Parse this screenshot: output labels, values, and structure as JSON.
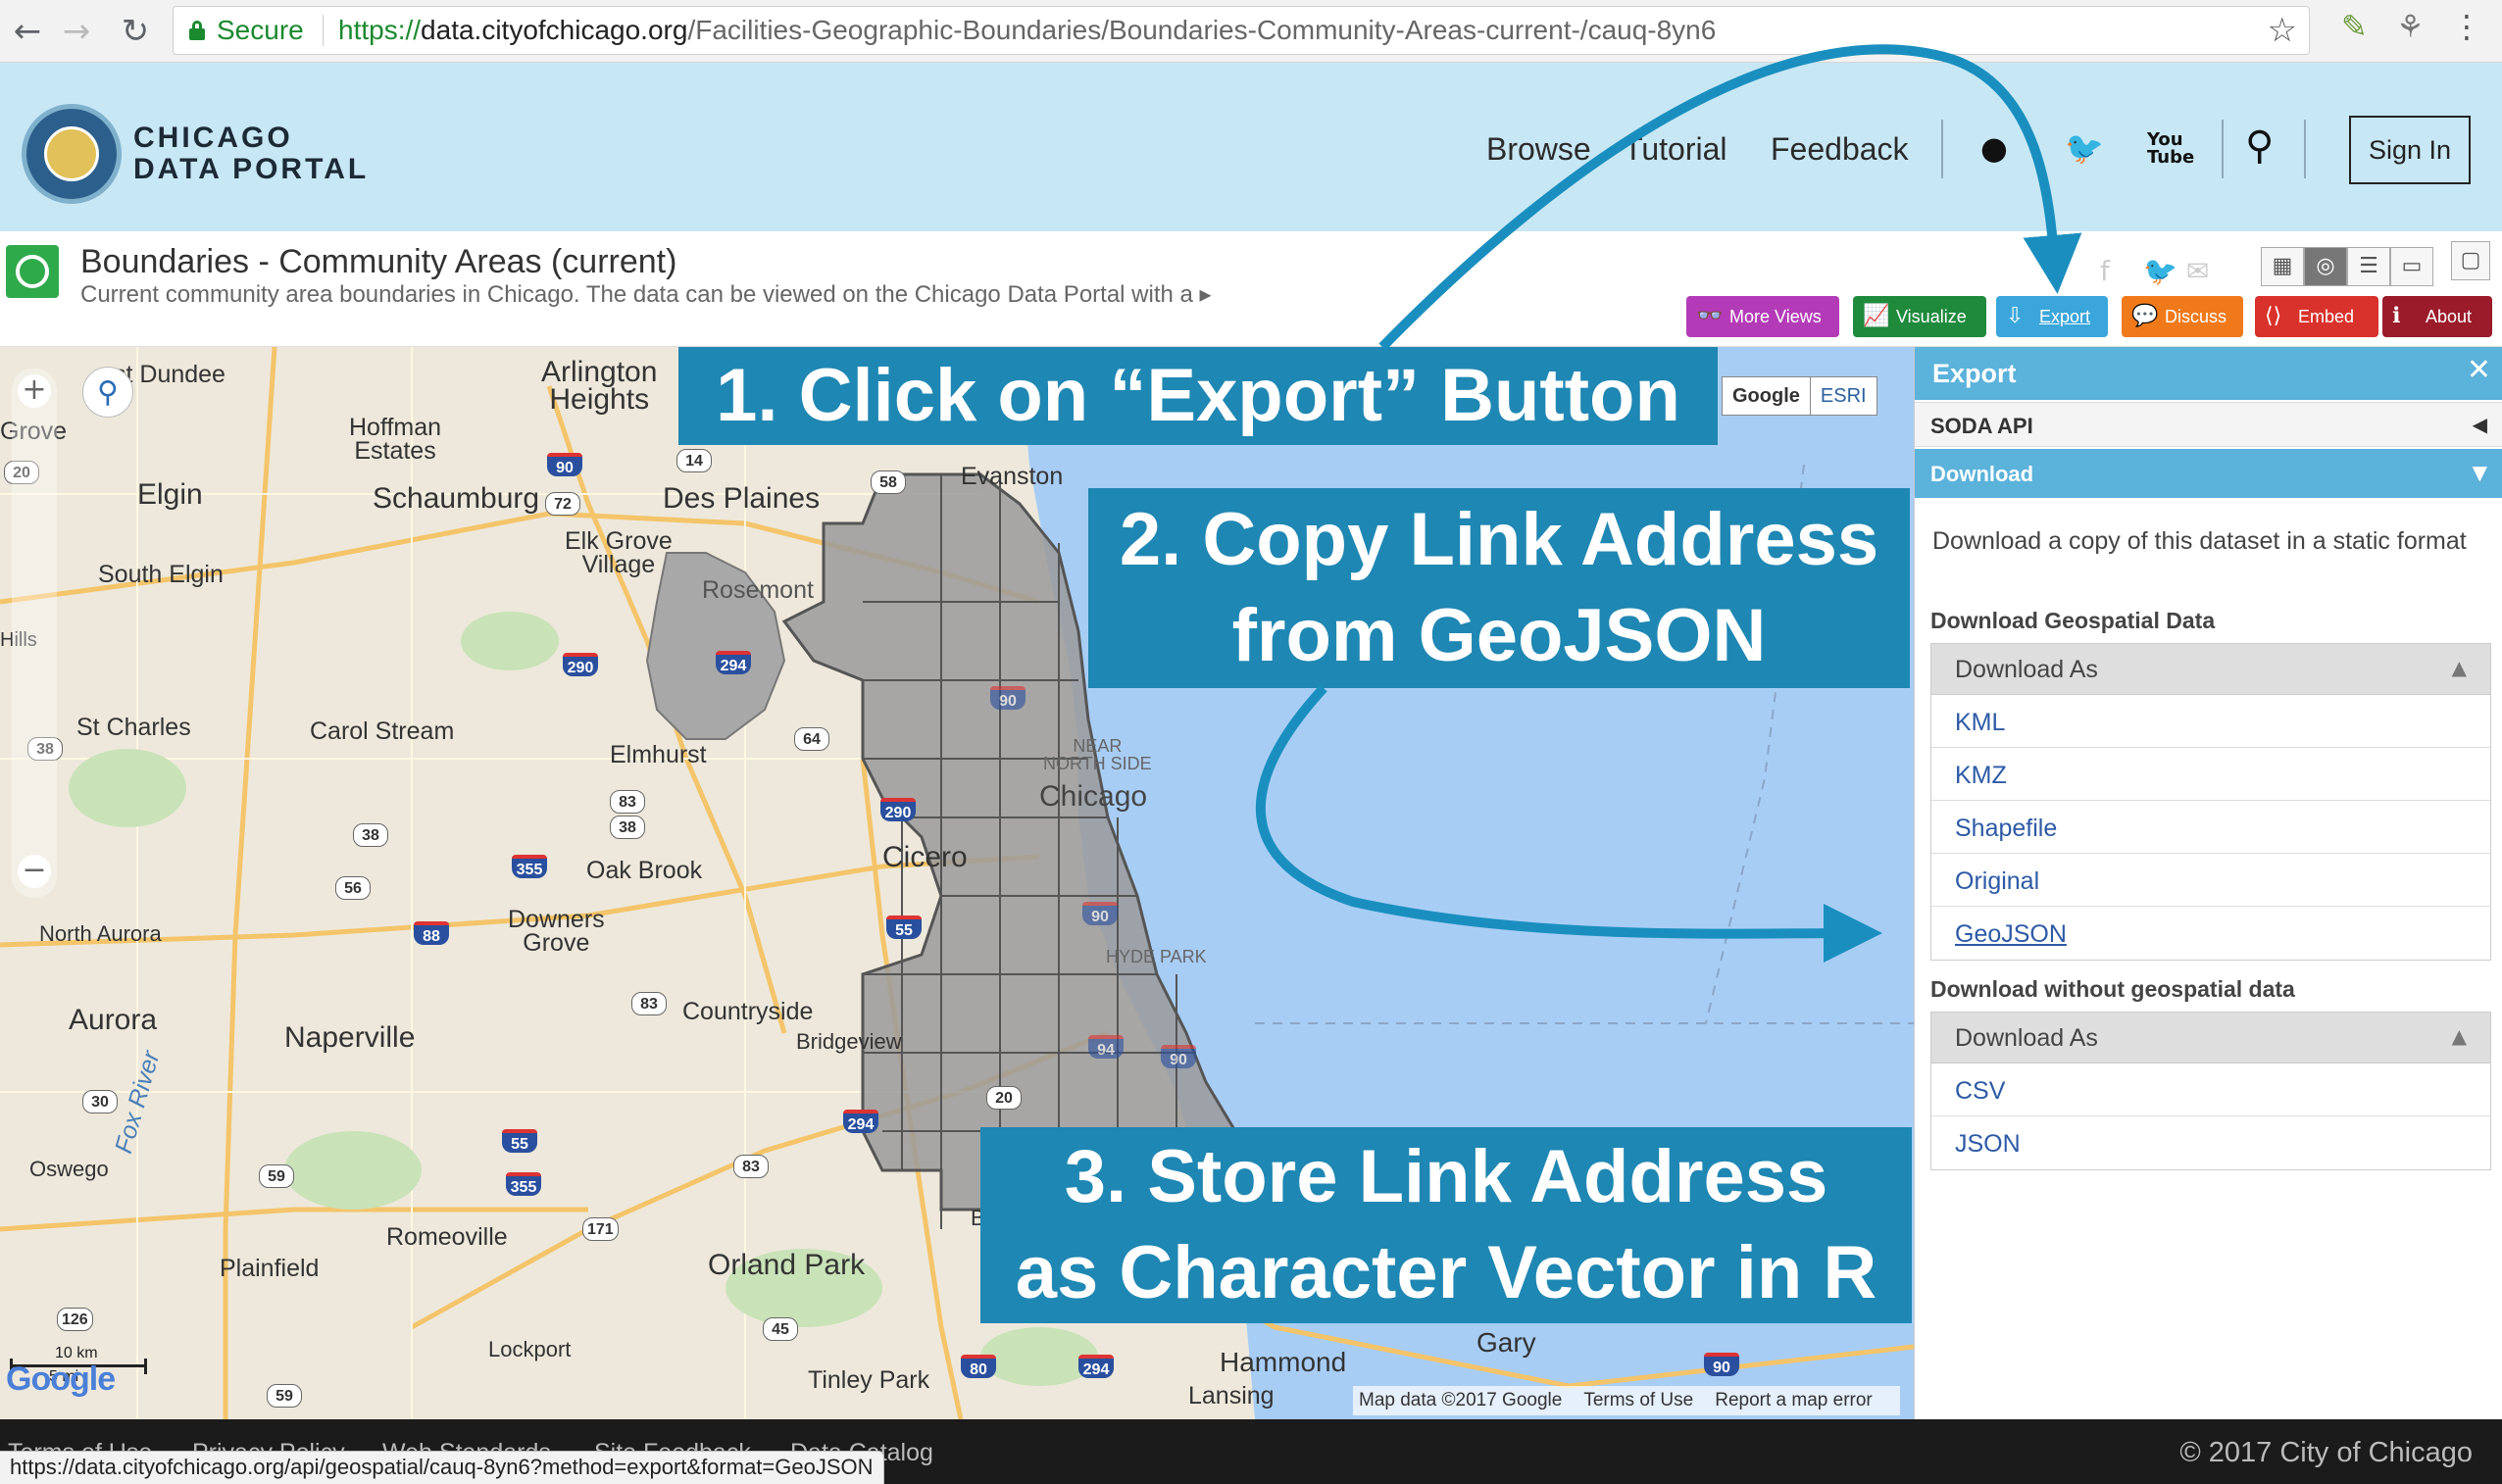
{
  "browser": {
    "secure_label": "Secure",
    "url_scheme": "https://",
    "url_host": "data.cityofchicago.org",
    "url_path": "/Facilities-Geographic-Boundaries/Boundaries-Community-Areas-current-/cauq-8yn6",
    "back_glyph": "←",
    "forward_glyph": "→",
    "reload_glyph": "↻",
    "star_glyph": "☆",
    "menu_glyph": "⋮"
  },
  "header": {
    "logo_line1": "CHICAGO",
    "logo_line2": "DATA PORTAL",
    "nav": [
      "Browse",
      "Tutorial",
      "Feedback"
    ],
    "social": {
      "github": "●",
      "twitter": "🐦",
      "youtube": "You\nTube",
      "search": "⚲"
    },
    "sign_in": "Sign In"
  },
  "dataset": {
    "title": "Boundaries - Community Areas (current)",
    "description": "Current community area boundaries in Chicago. The data can be viewed on the Chicago Data Portal with a ▸",
    "share": [
      "f",
      "🐦",
      "✉"
    ],
    "view_toggles": [
      "▦",
      "◎",
      "☰",
      "▭",
      "▢"
    ],
    "actions": [
      {
        "label": "More Views",
        "icon": "👓",
        "color": "#b43bb8"
      },
      {
        "label": "Visualize",
        "icon": "📈",
        "color": "#1f8a3c"
      },
      {
        "label": "Export",
        "icon": "⇩",
        "color": "#3aa6db"
      },
      {
        "label": "Discuss",
        "icon": "💬",
        "color": "#f07a1a"
      },
      {
        "label": "Embed",
        "icon": "⟨⟩",
        "color": "#d9312b"
      },
      {
        "label": "About",
        "icon": "ℹ",
        "color": "#9b1b2a"
      }
    ]
  },
  "map": {
    "zoom_in": "+",
    "zoom_out": "−",
    "pegman": "⚲",
    "basemap": {
      "google": "Google",
      "esri": "ESRI"
    },
    "places": [
      {
        "name": "st Dundee"
      },
      {
        "name": "Arlington\nHeights"
      },
      {
        "name": "Grove"
      },
      {
        "name": "Hoffman\nEstates"
      },
      {
        "name": "Elgin"
      },
      {
        "name": "Schaumburg"
      },
      {
        "name": "Des Plaines"
      },
      {
        "name": "Evanston"
      },
      {
        "name": "South Elgin"
      },
      {
        "name": "Elk Grove\nVillage"
      },
      {
        "name": "Rosemont"
      },
      {
        "name": "Hills"
      },
      {
        "name": "St Charles"
      },
      {
        "name": "Carol Stream"
      },
      {
        "name": "Elmhurst"
      },
      {
        "name": "Chicago"
      },
      {
        "name": "Cicero"
      },
      {
        "name": "Oak Brook"
      },
      {
        "name": "North Aurora"
      },
      {
        "name": "Downers\nGrove"
      },
      {
        "name": "Aurora"
      },
      {
        "name": "Naperville"
      },
      {
        "name": "Countryside"
      },
      {
        "name": "Bridgeview"
      },
      {
        "name": "Oswego"
      },
      {
        "name": "Romeoville"
      },
      {
        "name": "Plainfield"
      },
      {
        "name": "Orland Park"
      },
      {
        "name": "Lockport"
      },
      {
        "name": "Tinley Park"
      },
      {
        "name": "Hammond"
      },
      {
        "name": "Gary"
      },
      {
        "name": "Lansing"
      },
      {
        "name": "NEAR\nNORTH SIDE"
      },
      {
        "name": "HYDE PARK"
      },
      {
        "name": "Fox River"
      },
      {
        "name": "B"
      }
    ],
    "shields": [
      "20",
      "90",
      "14",
      "58",
      "72",
      "290",
      "294",
      "90",
      "38",
      "64",
      "83",
      "38",
      "290",
      "38",
      "355",
      "56",
      "88",
      "55",
      "83",
      "30",
      "90",
      "94",
      "90",
      "20",
      "294",
      "55",
      "83",
      "59",
      "355",
      "171",
      "126",
      "45",
      "80",
      "294",
      "90",
      "59"
    ],
    "scale_km": "10 km",
    "scale_mi": "5 mi",
    "google_logo": "Google",
    "attribution": [
      "Map data ©2017 Google",
      "Terms of Use",
      "Report a map error"
    ]
  },
  "banners": {
    "step1": "1. Click on “Export” Button",
    "step2_line1": "2. Copy Link Address",
    "step2_line2": "from GeoJSON",
    "step3_line1": "3. Store Link Address",
    "step3_line2": "as Character Vector in R"
  },
  "sidebar": {
    "title": "Export",
    "close": "✕",
    "soda_api": "SODA API",
    "soda_arrow": "◀",
    "download": "Download",
    "download_arrow": "▼",
    "description": "Download a copy of this dataset in a static format",
    "geo_heading": "Download Geospatial Data",
    "geo_download_as": "Download As",
    "geo_formats": [
      "KML",
      "KMZ",
      "Shapefile",
      "Original",
      "GeoJSON"
    ],
    "nongeo_heading": "Download without geospatial data",
    "nongeo_download_as": "Download As",
    "nongeo_formats": [
      "CSV",
      "JSON"
    ],
    "collapse_arrow": "▲"
  },
  "footer": {
    "links": [
      "Terms of Use",
      "Privacy Policy",
      "Web Standards",
      "Site Feedback",
      "Data Catalog"
    ],
    "copyright": "© 2017 City of Chicago",
    "status_url": "https://data.cityofchicago.org/api/geospatial/cauq-8yn6?method=export&format=GeoJSON"
  },
  "colors": {
    "header_bg": "#c7e7f5",
    "banner": "#1f87b3",
    "export_accent": "#5bb2db",
    "lake": "#a8cdf5",
    "community_areas": "#9a9a9a",
    "arrow": "#1a8fbf"
  }
}
